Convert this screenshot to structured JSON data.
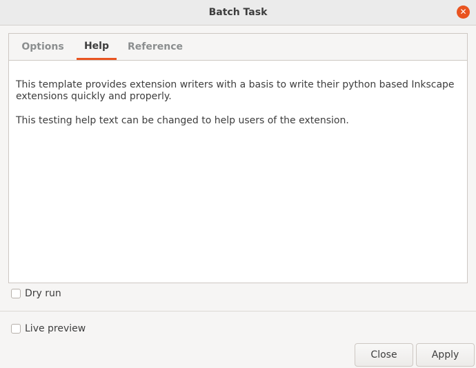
{
  "window": {
    "title": "Batch Task"
  },
  "tabs": [
    {
      "label": "Options",
      "active": false
    },
    {
      "label": "Help",
      "active": true
    },
    {
      "label": "Reference",
      "active": false
    }
  ],
  "help": {
    "paragraph1": "This template provides extension writers with a basis to write their python based Inkscape extensions quickly and properly.",
    "paragraph2": "This testing help text can be changed to help users of the extension."
  },
  "options": {
    "dry_run_label": "Dry run",
    "dry_run_checked": false,
    "live_preview_label": "Live preview",
    "live_preview_checked": false
  },
  "buttons": {
    "close_label": "Close",
    "apply_label": "Apply"
  },
  "colors": {
    "accent": "#e95420"
  }
}
